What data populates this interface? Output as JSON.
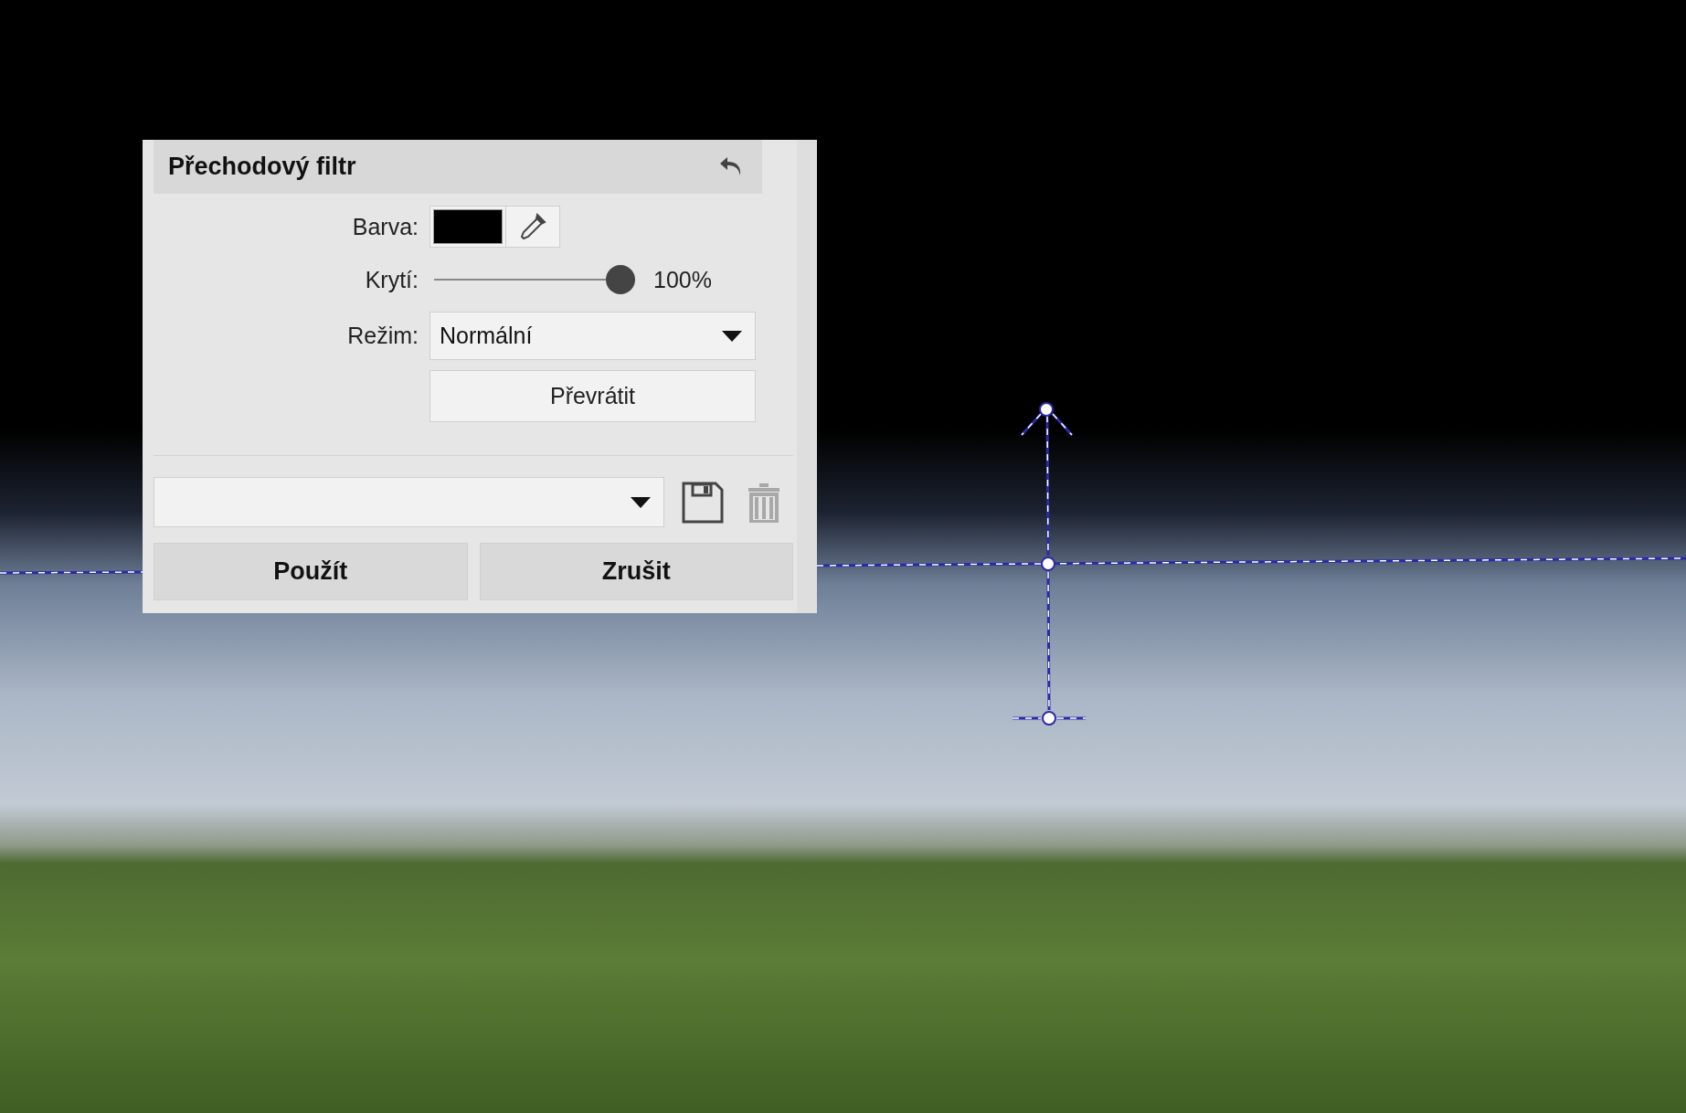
{
  "panel": {
    "title": "Přechodový filtr",
    "color_field": {
      "label": "Barva:",
      "color": "#000000"
    },
    "opacity": {
      "label": "Krytí:",
      "level": 1.0,
      "reading": "100%"
    },
    "mode": {
      "label": "Režim:",
      "value": "Normální"
    },
    "flip_button": "Převrátit",
    "preset": {
      "delete_disabled": true
    },
    "buttons": [
      "Použít",
      "Zrušit"
    ]
  }
}
